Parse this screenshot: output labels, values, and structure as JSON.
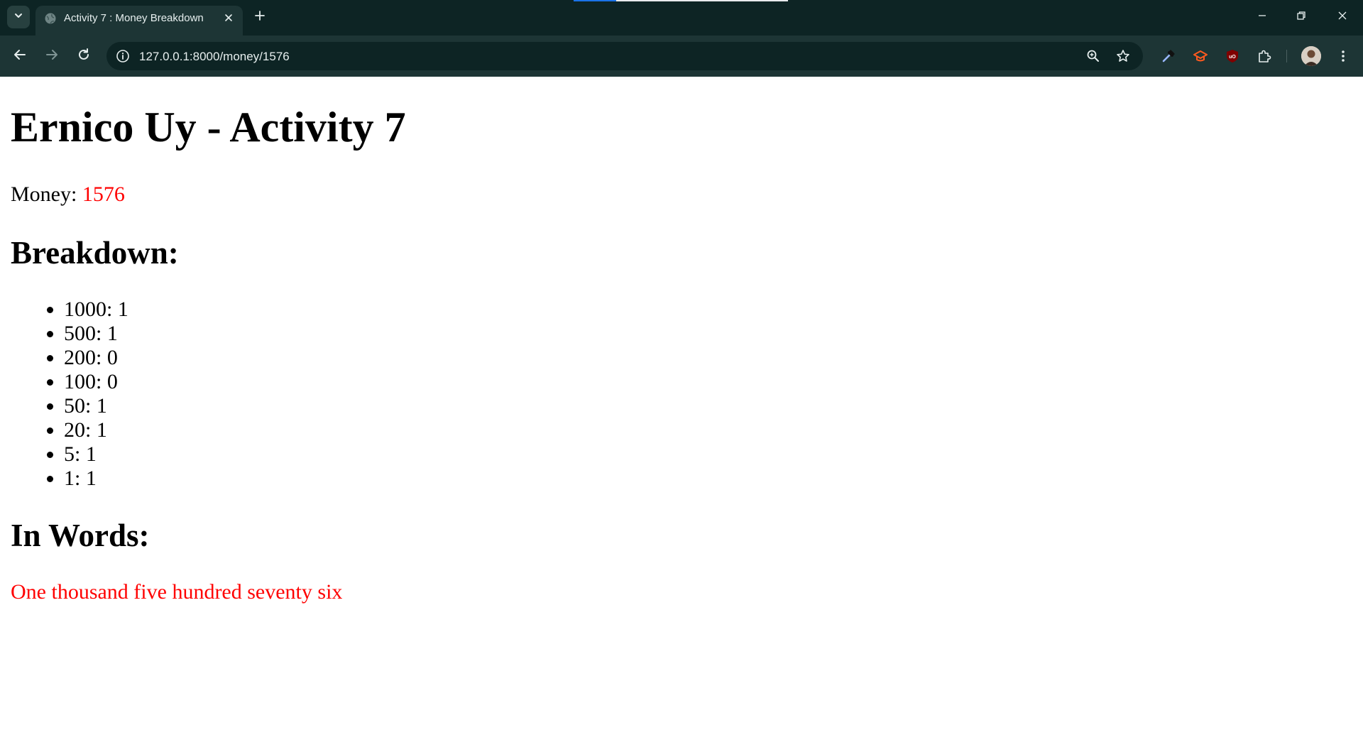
{
  "browser": {
    "tab": {
      "title": "Activity 7 : Money Breakdown"
    },
    "address_bar": {
      "url": "127.0.0.1:8000/money/1576"
    },
    "icons": {
      "tab_search": "chevron-down-icon",
      "favicon": "globe-icon",
      "tab_close": "close-icon",
      "new_tab": "plus-icon",
      "minimize": "minimize-icon",
      "restore": "restore-icon",
      "close_window": "close-icon",
      "back": "arrow-left-icon",
      "forward": "arrow-right-icon",
      "reload": "reload-icon",
      "site_info": "info-icon",
      "zoom": "zoom-icon",
      "bookmark": "star-icon",
      "eyedropper": "eyedropper-icon",
      "education_extension": "graduation-cap-icon",
      "ublock_extension": "ublock-icon",
      "extensions": "puzzle-icon",
      "profile": "avatar",
      "menu": "kebab-menu-icon"
    }
  },
  "page": {
    "heading": "Ernico Uy - Activity 7",
    "money": {
      "label": "Money: ",
      "value": "1576",
      "value_color": "#ff0000"
    },
    "breakdown": {
      "heading": "Breakdown:",
      "items": [
        {
          "text": "1000: 1"
        },
        {
          "text": "500: 1"
        },
        {
          "text": "200: 0"
        },
        {
          "text": "100: 0"
        },
        {
          "text": "50: 1"
        },
        {
          "text": "20: 1"
        },
        {
          "text": "5: 1"
        },
        {
          "text": "1: 1"
        }
      ]
    },
    "in_words": {
      "heading": "In Words:",
      "text": "One thousand five hundred seventy six",
      "color": "#ff0000"
    }
  }
}
